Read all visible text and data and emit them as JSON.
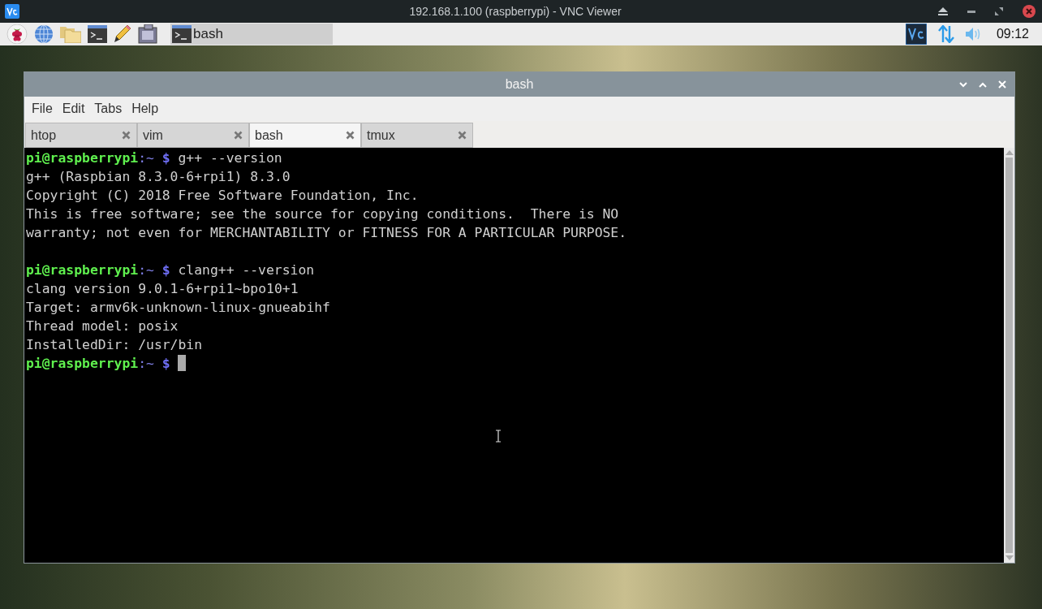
{
  "viewer": {
    "title": "192.168.1.100 (raspberrypi) - VNC Viewer"
  },
  "taskbar": {
    "task": {
      "label": "bash",
      "selected": true
    },
    "clock": "09:12"
  },
  "window": {
    "title": "bash"
  },
  "menu": [
    "File",
    "Edit",
    "Tabs",
    "Help"
  ],
  "tabs": [
    {
      "label": "htop",
      "selected": false
    },
    {
      "label": "vim",
      "selected": false
    },
    {
      "label": "bash",
      "selected": true
    },
    {
      "label": "tmux",
      "selected": false
    }
  ],
  "terminal": [
    {
      "kind": "prompt",
      "user": "pi@raspberrypi",
      "path": ":~",
      "symbol": "$",
      "command": "g++ --version"
    },
    {
      "kind": "output",
      "text": "g++ (Raspbian 8.3.0-6+rpi1) 8.3.0"
    },
    {
      "kind": "output",
      "text": "Copyright (C) 2018 Free Software Foundation, Inc."
    },
    {
      "kind": "output",
      "text": "This is free software; see the source for copying conditions.  There is NO"
    },
    {
      "kind": "output",
      "text": "warranty; not even for MERCHANTABILITY or FITNESS FOR A PARTICULAR PURPOSE."
    },
    {
      "kind": "blank"
    },
    {
      "kind": "prompt",
      "user": "pi@raspberrypi",
      "path": ":~",
      "symbol": "$",
      "command": "clang++ --version"
    },
    {
      "kind": "output",
      "text": "clang version 9.0.1-6+rpi1~bpo10+1"
    },
    {
      "kind": "output",
      "text": "Target: armv6k-unknown-linux-gnueabihf"
    },
    {
      "kind": "output",
      "text": "Thread model: posix"
    },
    {
      "kind": "output",
      "text": "InstalledDir: /usr/bin"
    },
    {
      "kind": "prompt",
      "user": "pi@raspberrypi",
      "path": ":~",
      "symbol": "$",
      "cursor": true
    }
  ]
}
